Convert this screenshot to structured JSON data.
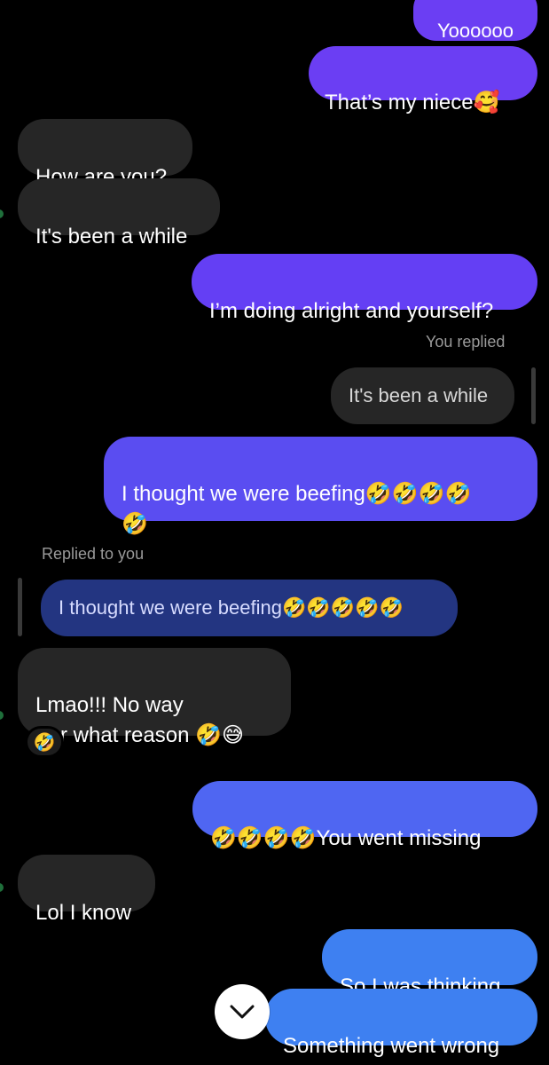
{
  "colors": {
    "incoming_bubble": "#262626",
    "sent_purple": "#6a3ef5",
    "sent_violet": "#5d4cf2",
    "sent_blue": "#4f67f2",
    "sent_lightblue": "#3f7ff0",
    "reply_quote_blue": "#233581"
  },
  "thread": {
    "top_partial_text": "Yoooooo",
    "messages": [
      {
        "side": "out",
        "text": "That’s my niece🥰"
      },
      {
        "side": "in",
        "text": "How are you?"
      },
      {
        "side": "in",
        "text": "It's been a while"
      },
      {
        "side": "out",
        "text": "I’m doing alright and yourself?"
      },
      {
        "side": "meta",
        "text": "You replied"
      },
      {
        "side": "quote",
        "text": "It's been a while"
      },
      {
        "side": "out",
        "text": "I thought we were beefing🤣🤣🤣🤣\n🤣"
      },
      {
        "side": "meta",
        "text": "Replied to you"
      },
      {
        "side": "quote",
        "text": "I thought we were beefing🤣🤣🤣🤣🤣"
      },
      {
        "side": "in",
        "text": "Lmao!!! No way\nFor what reason 🤣😅"
      },
      {
        "side": "reaction",
        "text": "🤣"
      },
      {
        "side": "out",
        "text": "🤣🤣🤣🤣You went missing"
      },
      {
        "side": "in",
        "text": "Lol I know"
      },
      {
        "side": "out",
        "text": "So I was thinking,"
      },
      {
        "side": "out",
        "text": "Something went wrong"
      }
    ]
  },
  "scroll_button": {
    "icon": "chevron-down-icon"
  }
}
